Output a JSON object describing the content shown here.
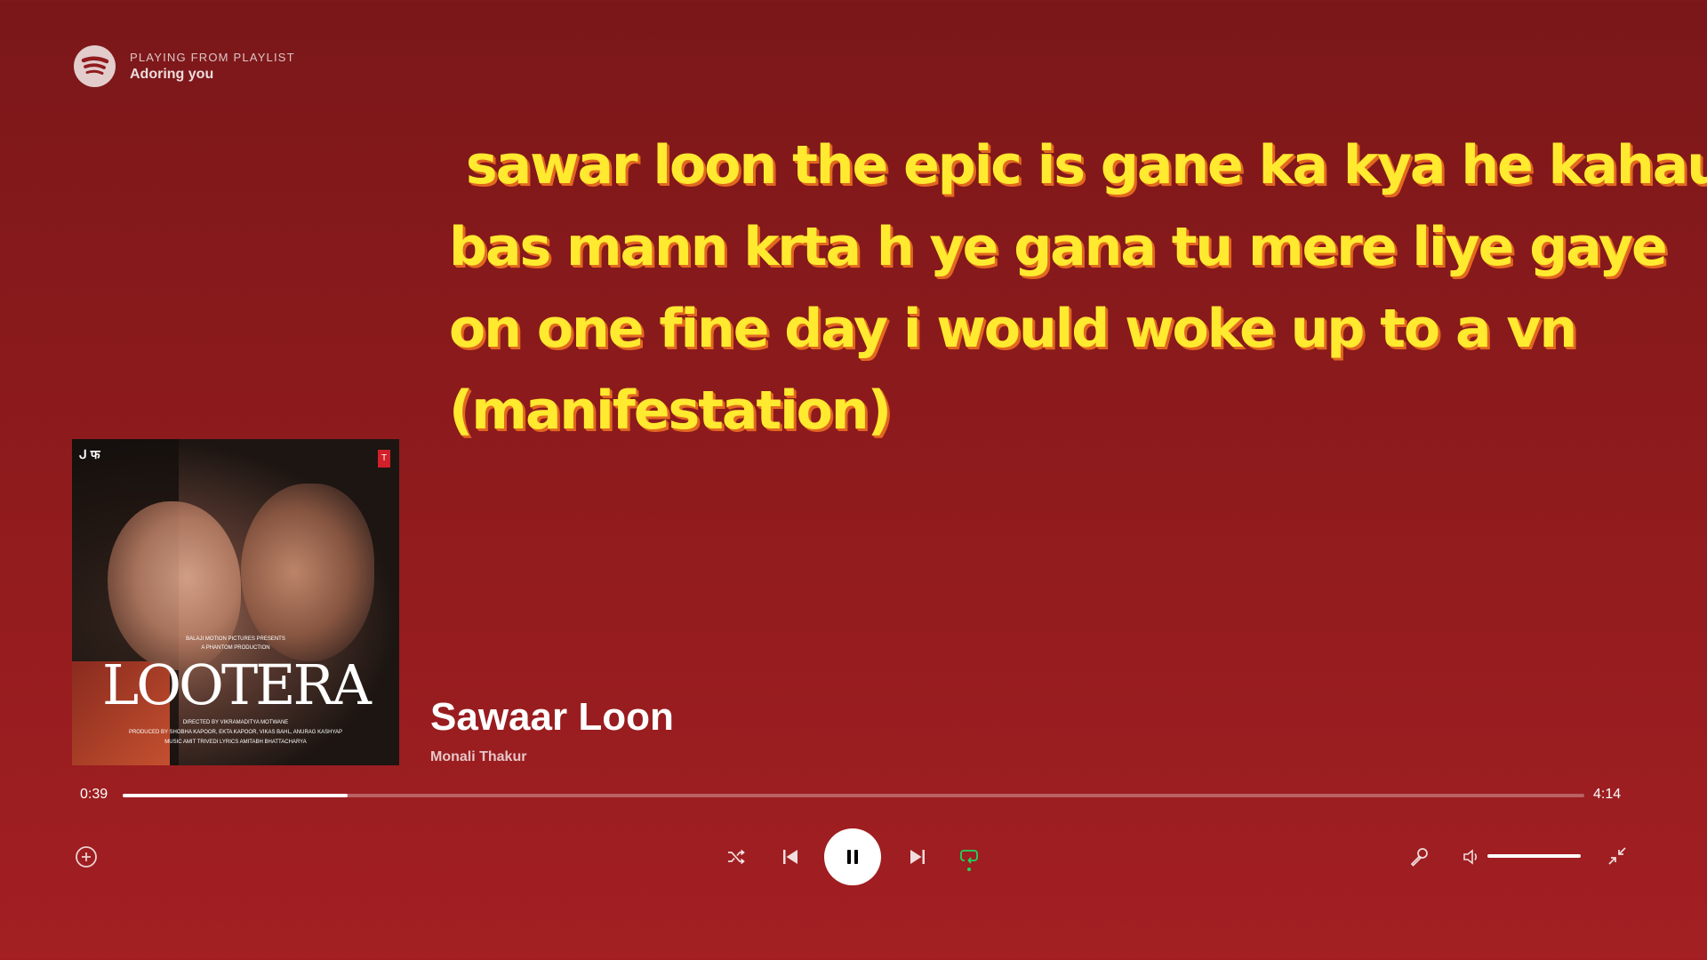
{
  "header": {
    "context_label": "PLAYING FROM PLAYLIST",
    "playlist_name": "Adoring you"
  },
  "lyrics": [
    " sawar loon the epic is gane ka kya he kahau",
    "bas mann krta h ye gana tu mere liye gaye",
    "on one fine day i would woke up to a vn",
    "(manifestation)"
  ],
  "album_art": {
    "logo_left": "ᒍ फ",
    "logo_right": "T",
    "presents": "BALAJI MOTION PICTURES PRESENTS",
    "production": "A PHANTOM PRODUCTION",
    "title": "LOOTERA",
    "credits": [
      "DIRECTED BY VIKRAMADITYA MOTWANE",
      "PRODUCED BY SHOBHA KAPOOR, EKTA KAPOOR, VIKAS BAHL, ANURAG KASHYAP",
      "MUSIC AMIT TRIVEDI  LYRICS AMITABH BHATTACHARYA"
    ]
  },
  "track": {
    "title": "Sawaar Loon",
    "artist": "Monali Thakur"
  },
  "playback": {
    "elapsed": "0:39",
    "total": "4:14",
    "progress_fraction": 0.154,
    "state": "playing",
    "repeat_active": true,
    "volume_fraction": 1.0
  },
  "colors": {
    "background_top": "#7b1719",
    "background_bottom": "#a31f22",
    "lyric_text": "#ffea2f",
    "lyric_shadow": "#e2671f",
    "active_green": "#1ed760"
  },
  "icons": {
    "logo": "spotify-logo-icon",
    "add": "add-circle-icon",
    "shuffle": "shuffle-icon",
    "previous": "skip-previous-icon",
    "pause": "pause-icon",
    "next": "skip-next-icon",
    "repeat": "repeat-icon",
    "lyrics": "microphone-icon",
    "volume": "volume-icon",
    "minimize": "minimize-icon"
  }
}
